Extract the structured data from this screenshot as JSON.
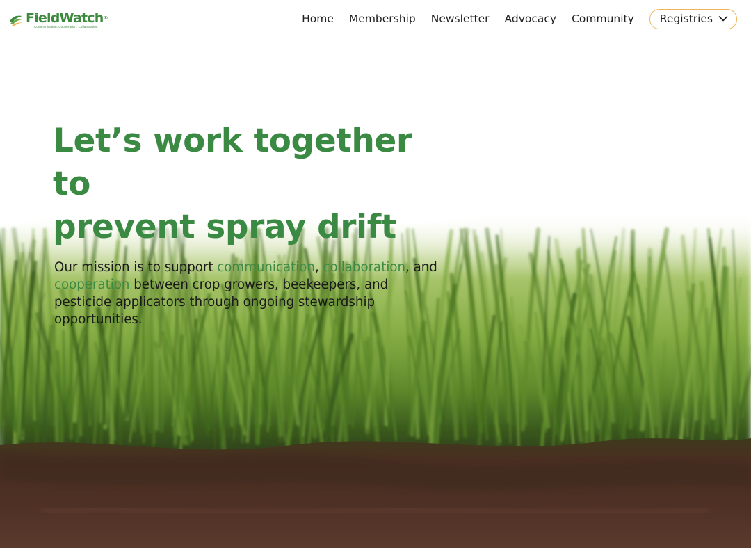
{
  "brand": {
    "name_part1": "Field",
    "name_part2": "Watch",
    "trademark": "®",
    "tagline": "Communication. Cooperation. Collaboration.",
    "logo_icon": "leaf-fan-icon",
    "color": "#3d8a3f"
  },
  "nav": {
    "items": [
      {
        "label": "Home"
      },
      {
        "label": "Membership"
      },
      {
        "label": "Newsletter"
      },
      {
        "label": "Advocacy"
      },
      {
        "label": "Community"
      }
    ],
    "dropdown": {
      "label": "Registries",
      "icon": "chevron-down-icon",
      "border_color": "#f0b45a"
    }
  },
  "hero": {
    "title_line1": "Let’s work together to",
    "title_line2": "prevent spray drift",
    "mission": {
      "part1": "Our mission is to support ",
      "highlight1": "communication",
      "sep1": ", ",
      "highlight2": "collaboration",
      "sep2": ", and ",
      "highlight3": "cooperation",
      "part2": " between crop growers, beekeepers, and pesticide applicators through ongoing stewardship opportunities."
    },
    "accent_color": "#3b8a44",
    "background_image": "grass-and-soil-illustration"
  }
}
